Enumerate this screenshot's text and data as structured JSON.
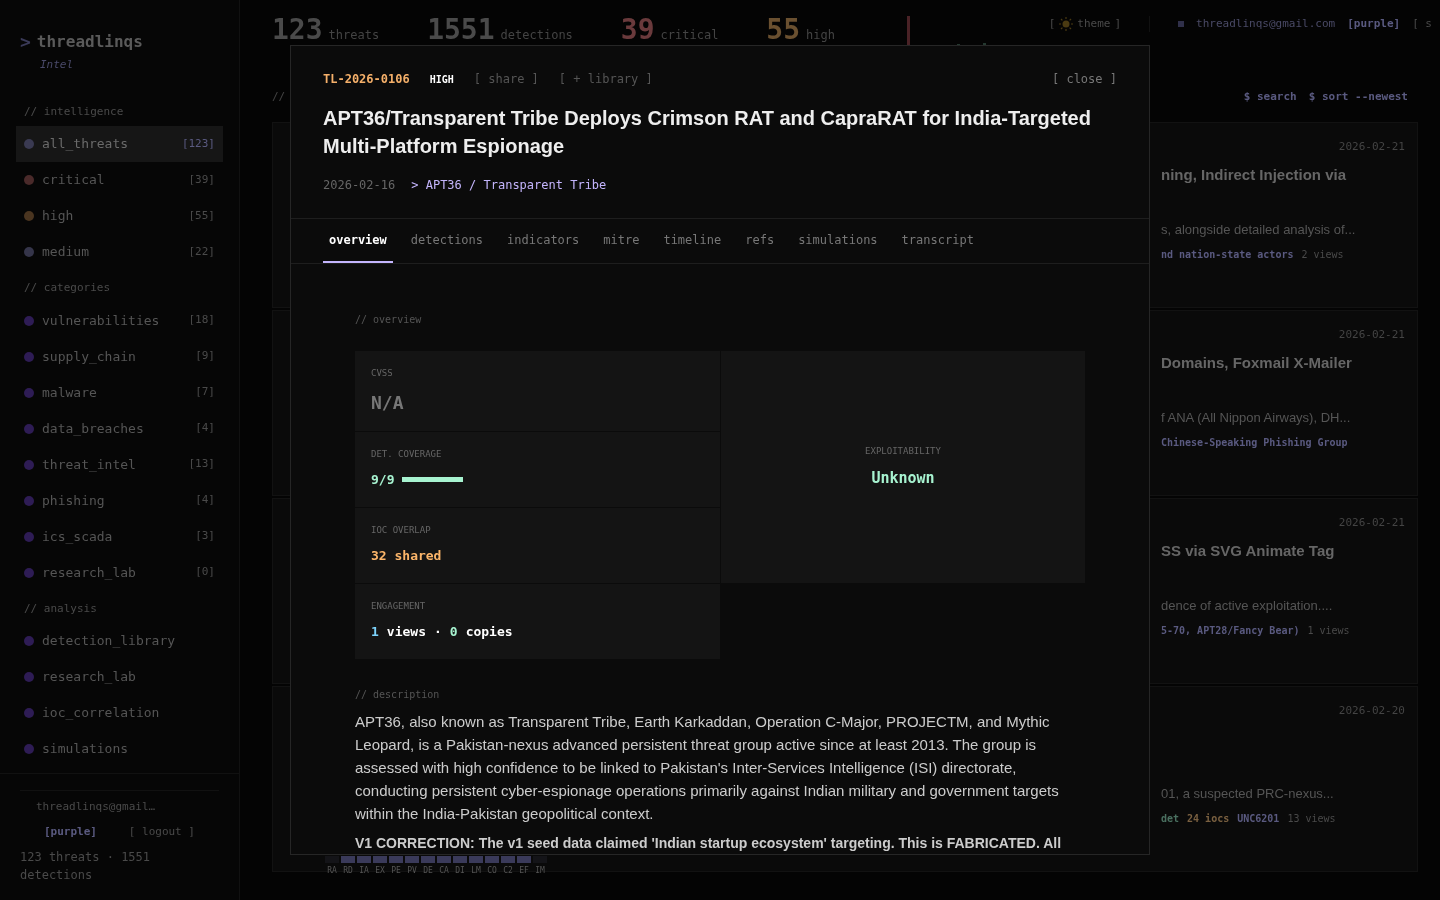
{
  "brand": {
    "prompt": ">",
    "name": "threadlinqs",
    "tagline": "Intel"
  },
  "sidebar": {
    "sections": [
      {
        "title": "// intelligence",
        "items": [
          {
            "label": "all_threats",
            "count": "[123]",
            "color": "#3a3a52",
            "selected": true
          },
          {
            "label": "critical",
            "count": "[39]",
            "color": "#4a2a2a",
            "selected": false
          },
          {
            "label": "high",
            "count": "[55]",
            "color": "#4a3520",
            "selected": false
          },
          {
            "label": "medium",
            "count": "[22]",
            "color": "#35354a",
            "selected": false
          }
        ]
      },
      {
        "title": "// categories",
        "items": [
          {
            "label": "vulnerabilities",
            "count": "[18]",
            "color": "#2e1c55",
            "selected": false
          },
          {
            "label": "supply_chain",
            "count": "[9]",
            "color": "#2e1c55",
            "selected": false
          },
          {
            "label": "malware",
            "count": "[7]",
            "color": "#2e1c55",
            "selected": false
          },
          {
            "label": "data_breaches",
            "count": "[4]",
            "color": "#2e1c55",
            "selected": false
          },
          {
            "label": "threat_intel",
            "count": "[13]",
            "color": "#2e1c55",
            "selected": false
          },
          {
            "label": "phishing",
            "count": "[4]",
            "color": "#2e1c55",
            "selected": false
          },
          {
            "label": "ics_scada",
            "count": "[3]",
            "color": "#2e1c55",
            "selected": false
          },
          {
            "label": "research_lab",
            "count": "[0]",
            "color": "#2e1c55",
            "selected": false
          }
        ]
      },
      {
        "title": "// analysis",
        "items": [
          {
            "label": "detection_library",
            "color": "#2e1c55",
            "selected": false
          },
          {
            "label": "research_lab",
            "color": "#2e1c55",
            "selected": false
          },
          {
            "label": "ioc_correlation",
            "color": "#2e1c55",
            "selected": false
          },
          {
            "label": "simulations",
            "color": "#2e1c55",
            "selected": false
          }
        ]
      }
    ],
    "footer": {
      "email": "threadlinqs@gmail…",
      "plan": "[purple]",
      "logout": "[ logout ]",
      "summary": "123 threats · 1551 detections"
    }
  },
  "stats": [
    {
      "value": "123",
      "label": "threats",
      "kind": "neutral"
    },
    {
      "value": "1551",
      "label": "detections",
      "kind": "neutral"
    },
    {
      "value": "39",
      "label": "critical",
      "kind": "critical"
    },
    {
      "value": "55",
      "label": "high",
      "kind": "high"
    }
  ],
  "header": {
    "bracket_open": "[",
    "theme": "theme",
    "bracket_close": "]",
    "email": "threadlinqs@gmail.com",
    "plan": "[purple]",
    "more": "[ s"
  },
  "toolbar": {
    "section": "//",
    "search": "$ search",
    "sort": "$ sort --newest"
  },
  "cards": [
    {
      "date": "2026-02-21",
      "title": "ning, Indirect Injection via",
      "summary": "s, alongside detailed analysis of...",
      "tags": [
        {
          "text": "nd nation-state actors",
          "kind": "actor"
        },
        {
          "text": "2 views",
          "kind": "views"
        }
      ]
    },
    {
      "date": "2026-02-21",
      "title": "Domains, Foxmail X-Mailer",
      "summary": "f ANA (All Nippon Airways), DH...",
      "tags": [
        {
          "text": "Chinese-Speaking Phishing Group",
          "kind": "actor"
        }
      ]
    },
    {
      "date": "2026-02-21",
      "title": "SS via SVG Animate Tag",
      "summary": "dence of active exploitation....",
      "tags": [
        {
          "text": "5-70, APT28/Fancy Bear)",
          "kind": "actor"
        },
        {
          "text": "1 views",
          "kind": "views"
        }
      ]
    },
    {
      "date": "2026-02-20",
      "summary": "01, a suspected PRC-nexus...",
      "tags": [
        {
          "text": "det",
          "kind": "det"
        },
        {
          "text": "24 iocs",
          "kind": "iocs"
        },
        {
          "text": "UNC6201",
          "kind": "actor"
        },
        {
          "text": "13 views",
          "kind": "views"
        }
      ]
    }
  ],
  "tactics": [
    {
      "label": "RA",
      "on": false
    },
    {
      "label": "RD",
      "on": true
    },
    {
      "label": "IA",
      "on": true
    },
    {
      "label": "EX",
      "on": true
    },
    {
      "label": "PE",
      "on": true
    },
    {
      "label": "PV",
      "on": true
    },
    {
      "label": "DE",
      "on": true
    },
    {
      "label": "CA",
      "on": true
    },
    {
      "label": "DI",
      "on": true
    },
    {
      "label": "LM",
      "on": true
    },
    {
      "label": "CO",
      "on": true
    },
    {
      "label": "C2",
      "on": true
    },
    {
      "label": "EF",
      "on": true
    },
    {
      "label": "IM",
      "on": false
    }
  ],
  "modal": {
    "id": "TL-2026-0106",
    "severity": "HIGH",
    "share": "[ share ]",
    "library": "[ + library ]",
    "close": "[ close ]",
    "title": "APT36/Transparent Tribe Deploys Crimson RAT and CapraRAT for India-Targeted Multi-Platform Espionage",
    "date": "2026-02-16",
    "actor": "> APT36 / Transparent Tribe",
    "tabs": [
      {
        "label": "overview",
        "selected": true
      },
      {
        "label": "detections",
        "selected": false
      },
      {
        "label": "indicators",
        "selected": false
      },
      {
        "label": "mitre",
        "selected": false
      },
      {
        "label": "timeline",
        "selected": false
      },
      {
        "label": "refs",
        "selected": false
      },
      {
        "label": "simulations",
        "selected": false
      },
      {
        "label": "transcript",
        "selected": false
      }
    ],
    "overview_heading": "// overview",
    "cvss": {
      "label": "CVSS",
      "value": "N/A"
    },
    "coverage": {
      "label": "DET. COVERAGE",
      "value": "9/9",
      "level": 1
    },
    "ioc": {
      "label": "IOC OVERLAP",
      "value": "32 shared"
    },
    "engagement": {
      "label": "ENGAGEMENT",
      "views": "1",
      "views_label": "views",
      "sep": "·",
      "copies": "0",
      "copies_label": "copies"
    },
    "exploitability": {
      "label": "EXPLOITABILITY",
      "value": "Unknown"
    },
    "description_heading": "// description",
    "description": "APT36, also known as Transparent Tribe, Earth Karkaddan, Operation C-Major, PROJECTM, and Mythic Leopard, is a Pakistan-nexus advanced persistent threat group active since at least 2013. The group is assessed with high confidence to be linked to Pakistan's Inter-Services Intelligence (ISI) directorate, conducting persistent cyber-espionage operations primarily against Indian military and government targets within the India-Pakistan geopolitical context.",
    "correction": "V1 CORRECTION: The v1 seed data claimed 'Indian startup ecosystem' targeting. This is FABRICATED. All"
  }
}
